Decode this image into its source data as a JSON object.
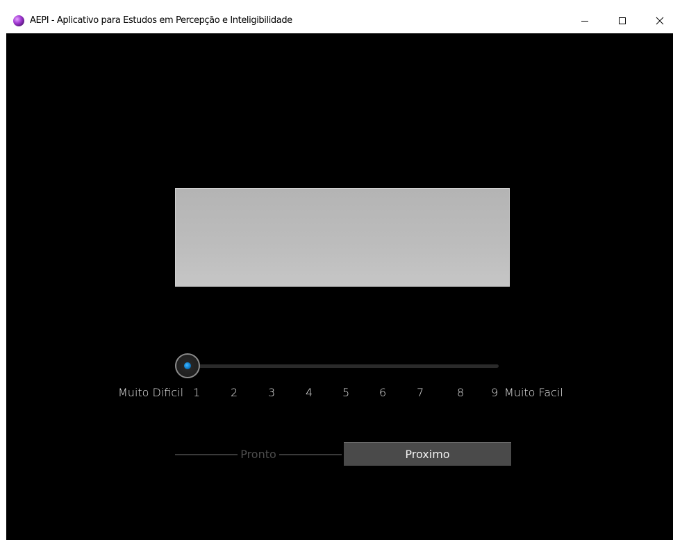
{
  "window": {
    "title": "AEPI - Aplicativo para Estudos em Percepção e Inteligibilidade"
  },
  "slider": {
    "min_label": "Muito Dificil",
    "max_label": "Muito Facil",
    "ticks": [
      "1",
      "2",
      "3",
      "4",
      "5",
      "6",
      "7",
      "8",
      "9"
    ],
    "value": 1
  },
  "buttons": {
    "pronto_label": "Pronto",
    "proximo_label": "Proximo"
  },
  "icons": {
    "app": "app-icon",
    "minimize": "minimize-icon",
    "maximize": "maximize-icon",
    "close": "close-icon"
  },
  "colors": {
    "background": "#000000",
    "handle_accent": "#0a78c8",
    "proximo_bg": "#4a4a4a"
  }
}
